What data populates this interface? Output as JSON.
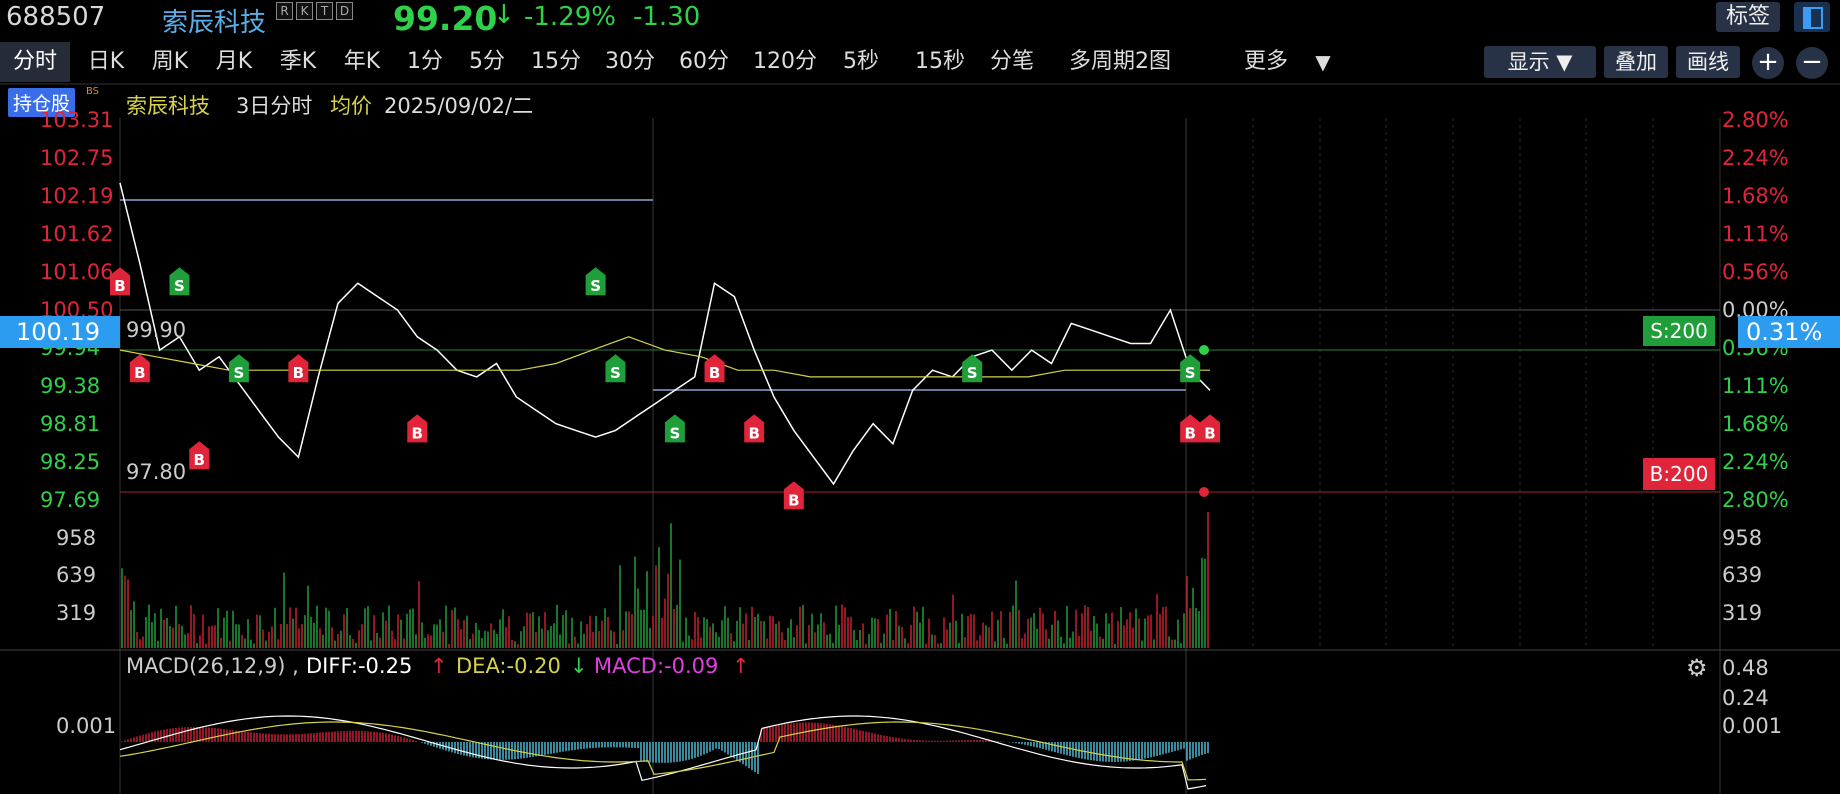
{
  "header": {
    "code": "688507",
    "name": "索辰科技",
    "tags": [
      "R",
      "K",
      "T",
      "D"
    ],
    "price": "99.20",
    "price_arrow": "↓",
    "change_pct": "-1.29%",
    "change": "-1.30",
    "tag_button": "标签"
  },
  "tabs": [
    "分时",
    "日K",
    "周K",
    "月K",
    "季K",
    "年K",
    "1分",
    "5分",
    "15分",
    "30分",
    "60分",
    "120分",
    "5秒",
    "15秒",
    "分笔",
    "多周期2图",
    "更多"
  ],
  "toolbar": {
    "display": "显示",
    "overlay": "叠加",
    "draw": "画线",
    "zoom_in": "+",
    "zoom_out": "−"
  },
  "info_bar": {
    "badge": "持仓股",
    "badge_mark": "BS",
    "name": "索辰科技",
    "period": "3日分时",
    "avg_label": "均价",
    "date": "2025/09/02/二"
  },
  "price_axis": {
    "left": [
      "103.31",
      "102.75",
      "102.19",
      "101.62",
      "101.06",
      "100.50",
      "99.94",
      "99.38",
      "98.81",
      "98.25",
      "97.69"
    ],
    "right": [
      "2.80%",
      "2.24%",
      "1.68%",
      "1.11%",
      "0.56%",
      "0.00%",
      "0.56%",
      "1.11%",
      "1.68%",
      "2.24%",
      "2.80%"
    ],
    "current_price": "100.19",
    "current_pct": "0.31%",
    "high_label": "99.90",
    "low_label": "97.80"
  },
  "orders": {
    "sell": "S:200",
    "buy": "B:200"
  },
  "volume_axis": [
    "958",
    "639",
    "319"
  ],
  "macd": {
    "label": "MACD(26,12,9) ,",
    "diff": "DIFF:-0.25",
    "diff_arrow": "↑",
    "dea": "DEA:-0.20",
    "dea_arrow": "↓",
    "macd": "MACD:-0.09",
    "macd_arrow": "↑",
    "left_axis": "0.001",
    "right_axis": [
      "0.48",
      "0.24",
      "0.001"
    ]
  },
  "colors": {
    "up": "#e0243a",
    "down": "#2fd04a",
    "accent": "#2c9cf0",
    "avg": "#d6d24a",
    "price_line": "#ffffff"
  },
  "chart_data": {
    "type": "line",
    "title": "",
    "y_range": [
      97.69,
      103.31
    ],
    "price_series": [
      102.4,
      101.2,
      99.9,
      100.1,
      99.6,
      99.8,
      99.4,
      99.0,
      98.6,
      98.3,
      99.5,
      100.6,
      100.9,
      100.7,
      100.5,
      100.1,
      99.9,
      99.6,
      99.5,
      99.7,
      99.2,
      99.0,
      98.8,
      98.7,
      98.6,
      98.7,
      98.9,
      99.1,
      99.3,
      99.5,
      100.9,
      100.7,
      99.9,
      99.2,
      98.7,
      98.3,
      97.9,
      98.4,
      98.8,
      98.5,
      99.3,
      99.6,
      99.5,
      99.8,
      99.9,
      99.6,
      99.9,
      99.7,
      100.3,
      100.2,
      100.1,
      100.0,
      100.0,
      100.5,
      99.6,
      99.3
    ],
    "avg_series": [
      99.9,
      99.8,
      99.7,
      99.6,
      99.6,
      99.6,
      99.6,
      99.6,
      99.6,
      99.6,
      99.6,
      99.6,
      99.7,
      99.9,
      100.1,
      99.9,
      99.8,
      99.6,
      99.6,
      99.5,
      99.5,
      99.5,
      99.5,
      99.5,
      99.5,
      99.5,
      99.6,
      99.6,
      99.6,
      99.6,
      99.6
    ],
    "buy_points": [
      [
        0,
        100.9
      ],
      [
        1,
        99.6
      ],
      [
        4,
        98.3
      ],
      [
        9,
        99.6
      ],
      [
        15,
        98.7
      ],
      [
        30,
        99.6
      ],
      [
        32,
        98.7
      ],
      [
        34,
        97.7
      ],
      [
        54,
        98.7
      ],
      [
        55,
        98.7
      ]
    ],
    "sell_points": [
      [
        3,
        100.9
      ],
      [
        6,
        99.6
      ],
      [
        24,
        100.9
      ],
      [
        25,
        99.6
      ],
      [
        28,
        98.7
      ],
      [
        43,
        99.6
      ],
      [
        54,
        99.6
      ]
    ]
  }
}
